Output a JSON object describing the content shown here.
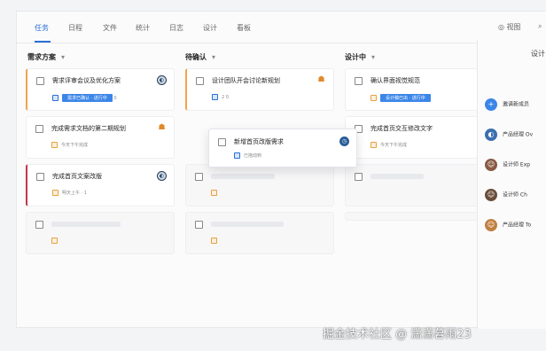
{
  "tabs": [
    {
      "label": "任务",
      "active": true
    },
    {
      "label": "日程"
    },
    {
      "label": "文件"
    },
    {
      "label": "统计"
    },
    {
      "label": "日志"
    },
    {
      "label": "设计"
    },
    {
      "label": "看板"
    }
  ],
  "topright": {
    "view_label": "视图",
    "search_icon": "search-icon"
  },
  "columns": [
    {
      "title": "需求方案",
      "cards": [
        {
          "title": "需求评审会议及优化方案",
          "tag": "需求已确认 · 进行中",
          "count": "0",
          "accent": "#f0a54a"
        },
        {
          "title": "完成需求文档的第二期规划",
          "meta": "今天下午完成"
        },
        {
          "title": "完成首页文案改版",
          "meta": "明天上午 · 1",
          "accent": "#c0394b"
        },
        {
          "title": ""
        }
      ]
    },
    {
      "title": "待确认",
      "cards": [
        {
          "title": "设计团队开会讨论新规划",
          "meta": "2  0",
          "accent": "#f0a54a"
        },
        {
          "title": ""
        },
        {
          "title": ""
        },
        {
          "title": ""
        }
      ]
    },
    {
      "title": "设计中",
      "cards": [
        {
          "title": "确认界面视觉规范",
          "tag": "设计稿已出 · 进行中"
        },
        {
          "title": "完成首页交互修改文字",
          "meta": "今天下午完成"
        },
        {
          "title": ""
        },
        {
          "title": ""
        }
      ]
    }
  ],
  "drag_card": {
    "title": "新增首页改版需求",
    "meta": "已拖动到"
  },
  "side": {
    "title": "设计",
    "invite_label": "邀请新成员",
    "members": [
      {
        "name": "产品经理 Ov",
        "color": "#3b6fb0"
      },
      {
        "name": "设计师 Exp",
        "color": "#8a5a44"
      },
      {
        "name": "设计师 Ch",
        "color": "#6a4e3a"
      },
      {
        "name": "产品经理 To",
        "color": "#c08040"
      }
    ]
  },
  "watermark": "掘金技术社区 @ 潇潇暮雨23"
}
